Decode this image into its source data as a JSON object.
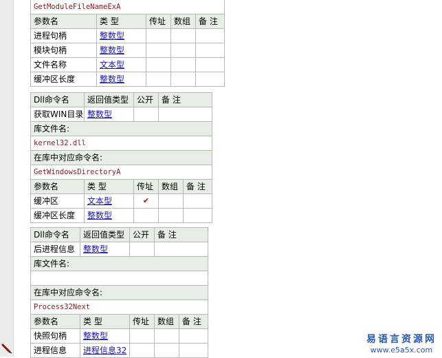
{
  "block1": {
    "name_row": "GetModuleFileNameExA",
    "param_headers": [
      "参数名",
      "类 型",
      "传址",
      "数组",
      "备 注"
    ],
    "params": [
      {
        "name": "进程句柄",
        "type": "整数型",
        "byref": "",
        "array": "",
        "note": ""
      },
      {
        "name": "模块句柄",
        "type": "整数型",
        "byref": "",
        "array": "",
        "note": ""
      },
      {
        "name": "文件名称",
        "type": "文本型",
        "byref": "",
        "array": "",
        "note": ""
      },
      {
        "name": "缓冲区长度",
        "type": "整数型",
        "byref": "",
        "array": "",
        "note": ""
      }
    ]
  },
  "block2": {
    "dll_headers": [
      "Dll命令名",
      "返回值类型",
      "公开",
      "备 注"
    ],
    "dll": {
      "name": "获取WIN目录",
      "return_type": "整数型",
      "public": "",
      "note": ""
    },
    "lib_label": "库文件名:",
    "lib_value": "kernel32.dll",
    "entry_label": "在库中对应命令名:",
    "entry_value": "GetWindowsDirectoryA",
    "param_headers": [
      "参数名",
      "类 型",
      "传址",
      "数组",
      "备 注"
    ],
    "params": [
      {
        "name": "缓冲区",
        "type": "文本型",
        "byref": "✔",
        "array": "",
        "note": ""
      },
      {
        "name": "缓冲区长度",
        "type": "整数型",
        "byref": "",
        "array": "",
        "note": ""
      }
    ]
  },
  "block3": {
    "dll_headers": [
      "Dll命令名",
      "返回值类型",
      "公开",
      "备 注"
    ],
    "dll": {
      "name": "后进程信息",
      "return_type": "整数型",
      "public": "",
      "note": ""
    },
    "lib_label": "库文件名:",
    "lib_value": "",
    "entry_label": "在库中对应命令名:",
    "entry_value": "Process32Next",
    "param_headers": [
      "参数名",
      "类 型",
      "传址",
      "数组",
      "备 注"
    ],
    "params": [
      {
        "name": "快照句柄",
        "type": "整数型",
        "byref": "",
        "array": "",
        "note": ""
      },
      {
        "name": "进程信息",
        "type": "进程信息32",
        "byref": "",
        "array": "",
        "note": ""
      }
    ]
  },
  "watermark": {
    "cn": "易语言资源网",
    "en": "www.e5a5x.com"
  },
  "icons": {
    "gutter": "pencil-icon",
    "check": "checkmark-icon"
  }
}
